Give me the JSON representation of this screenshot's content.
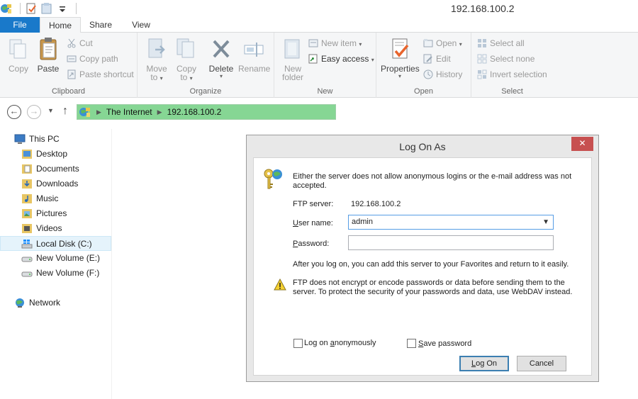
{
  "window": {
    "title": "192.168.100.2"
  },
  "ribbon": {
    "tabs": {
      "file": "File",
      "home": "Home",
      "share": "Share",
      "view": "View"
    },
    "clipboard": {
      "label": "Clipboard",
      "copy": "Copy",
      "paste": "Paste",
      "cut": "Cut",
      "copy_path": "Copy path",
      "paste_shortcut": "Paste shortcut"
    },
    "organize": {
      "label": "Organize",
      "move_to_1": "Move",
      "move_to_2": "to",
      "copy_to_1": "Copy",
      "copy_to_2": "to",
      "delete": "Delete",
      "rename": "Rename"
    },
    "new": {
      "label": "New",
      "new_folder_1": "New",
      "new_folder_2": "folder",
      "new_item": "New item",
      "easy_access": "Easy access"
    },
    "open": {
      "label": "Open",
      "properties": "Properties",
      "open": "Open",
      "edit": "Edit",
      "history": "History"
    },
    "select": {
      "label": "Select",
      "select_all": "Select all",
      "select_none": "Select none",
      "invert_selection": "Invert selection"
    }
  },
  "address_bar": {
    "segments": [
      "The Internet",
      "192.168.100.2"
    ]
  },
  "sidebar": {
    "this_pc": "This PC",
    "items": [
      "Desktop",
      "Documents",
      "Downloads",
      "Music",
      "Pictures",
      "Videos",
      "Local Disk (C:)",
      "New Volume (E:)",
      "New Volume (F:)"
    ],
    "network": "Network"
  },
  "dialog": {
    "title": "Log On As",
    "close": "✕",
    "message_line1": "Either the server does not allow anonymous logins or the e-mail address was not",
    "message_line2": "accepted.",
    "ftp_server_label": "FTP server:",
    "ftp_server_value": "192.168.100.2",
    "username_label": "User name:",
    "username_value": "admin",
    "password_label": "Password:",
    "password_value": "",
    "info": "After you log on, you can add this server to your Favorites and return to it easily.",
    "warning_line1": "FTP does not encrypt or encode passwords or data before sending them to the",
    "warning_line2": "server.  To protect the security of your passwords and data, use WebDAV instead.",
    "anonymous_label": "Log on anonymously",
    "save_password_label": "Save password",
    "logon_button": "Log On",
    "cancel_button": "Cancel"
  },
  "colors": {
    "accent": "#1979ca",
    "address_highlight": "#86d694",
    "close_button": "#c75050"
  }
}
